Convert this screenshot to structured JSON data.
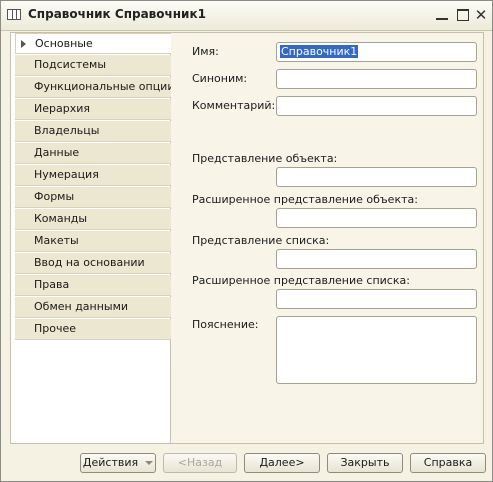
{
  "window": {
    "title": "Справочник Справочник1",
    "controls": {
      "minimize_icon": "minimize-icon",
      "maximize_icon": "maximize-icon",
      "close_icon": "close-icon"
    }
  },
  "sidebar": {
    "items": [
      {
        "label": "Основные",
        "active": true
      },
      {
        "label": "Подсистемы"
      },
      {
        "label": "Функциональные опции"
      },
      {
        "label": "Иерархия"
      },
      {
        "label": "Владельцы"
      },
      {
        "label": "Данные"
      },
      {
        "label": "Нумерация"
      },
      {
        "label": "Формы"
      },
      {
        "label": "Команды"
      },
      {
        "label": "Макеты"
      },
      {
        "label": "Ввод на основании"
      },
      {
        "label": "Права"
      },
      {
        "label": "Обмен данными"
      },
      {
        "label": "Прочее"
      }
    ]
  },
  "form": {
    "name_label": "Имя:",
    "name_value": "Справочник1",
    "synonym_label": "Синоним:",
    "synonym_value": "",
    "comment_label": "Комментарий:",
    "comment_value": "",
    "object_presentation_label": "Представление объекта:",
    "object_presentation_value": "",
    "ext_object_presentation_label": "Расширенное представление объекта:",
    "ext_object_presentation_value": "",
    "list_presentation_label": "Представление списка:",
    "list_presentation_value": "",
    "ext_list_presentation_label": "Расширенное представление списка:",
    "ext_list_presentation_value": "",
    "explanation_label": "Пояснение:",
    "explanation_value": ""
  },
  "buttons": {
    "actions": "Действия",
    "back": "<Назад",
    "next": "Далее>",
    "close": "Закрыть",
    "help": "Справка"
  },
  "colors": {
    "selection": "#3169c6",
    "window_bg": "#f5f2e4",
    "tab_bg": "#ece7d1"
  }
}
